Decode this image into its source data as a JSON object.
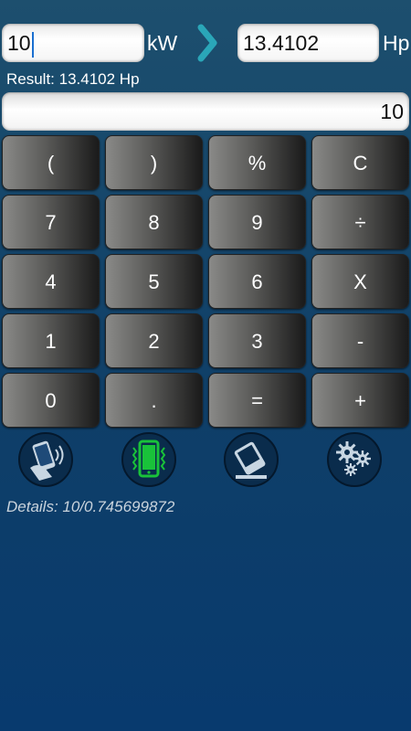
{
  "converter": {
    "from_value": "10",
    "from_unit": "kW",
    "to_value": "13.4102",
    "to_unit": "Hp",
    "result_text": "Result: 13.4102 Hp"
  },
  "display": {
    "value": "10"
  },
  "keypad": {
    "rows": [
      [
        "(",
        ")",
        "%",
        "C"
      ],
      [
        "7",
        "8",
        "9",
        "÷"
      ],
      [
        "4",
        "5",
        "6",
        "X"
      ],
      [
        "1",
        "2",
        "3",
        "-"
      ],
      [
        "0",
        ".",
        "=",
        "+"
      ]
    ]
  },
  "tools": [
    {
      "icon": "shake-phone-icon",
      "color": "#1e4a78"
    },
    {
      "icon": "vibrate-phone-icon",
      "color": "#19c23a"
    },
    {
      "icon": "eraser-icon",
      "color": "#1e4a78"
    },
    {
      "icon": "settings-gears-icon",
      "color": "#1e4a78"
    }
  ],
  "details": {
    "text": "Details: 10/0.745699872"
  },
  "colors": {
    "accent": "#2aa6b8",
    "background": "#0f3f68"
  }
}
